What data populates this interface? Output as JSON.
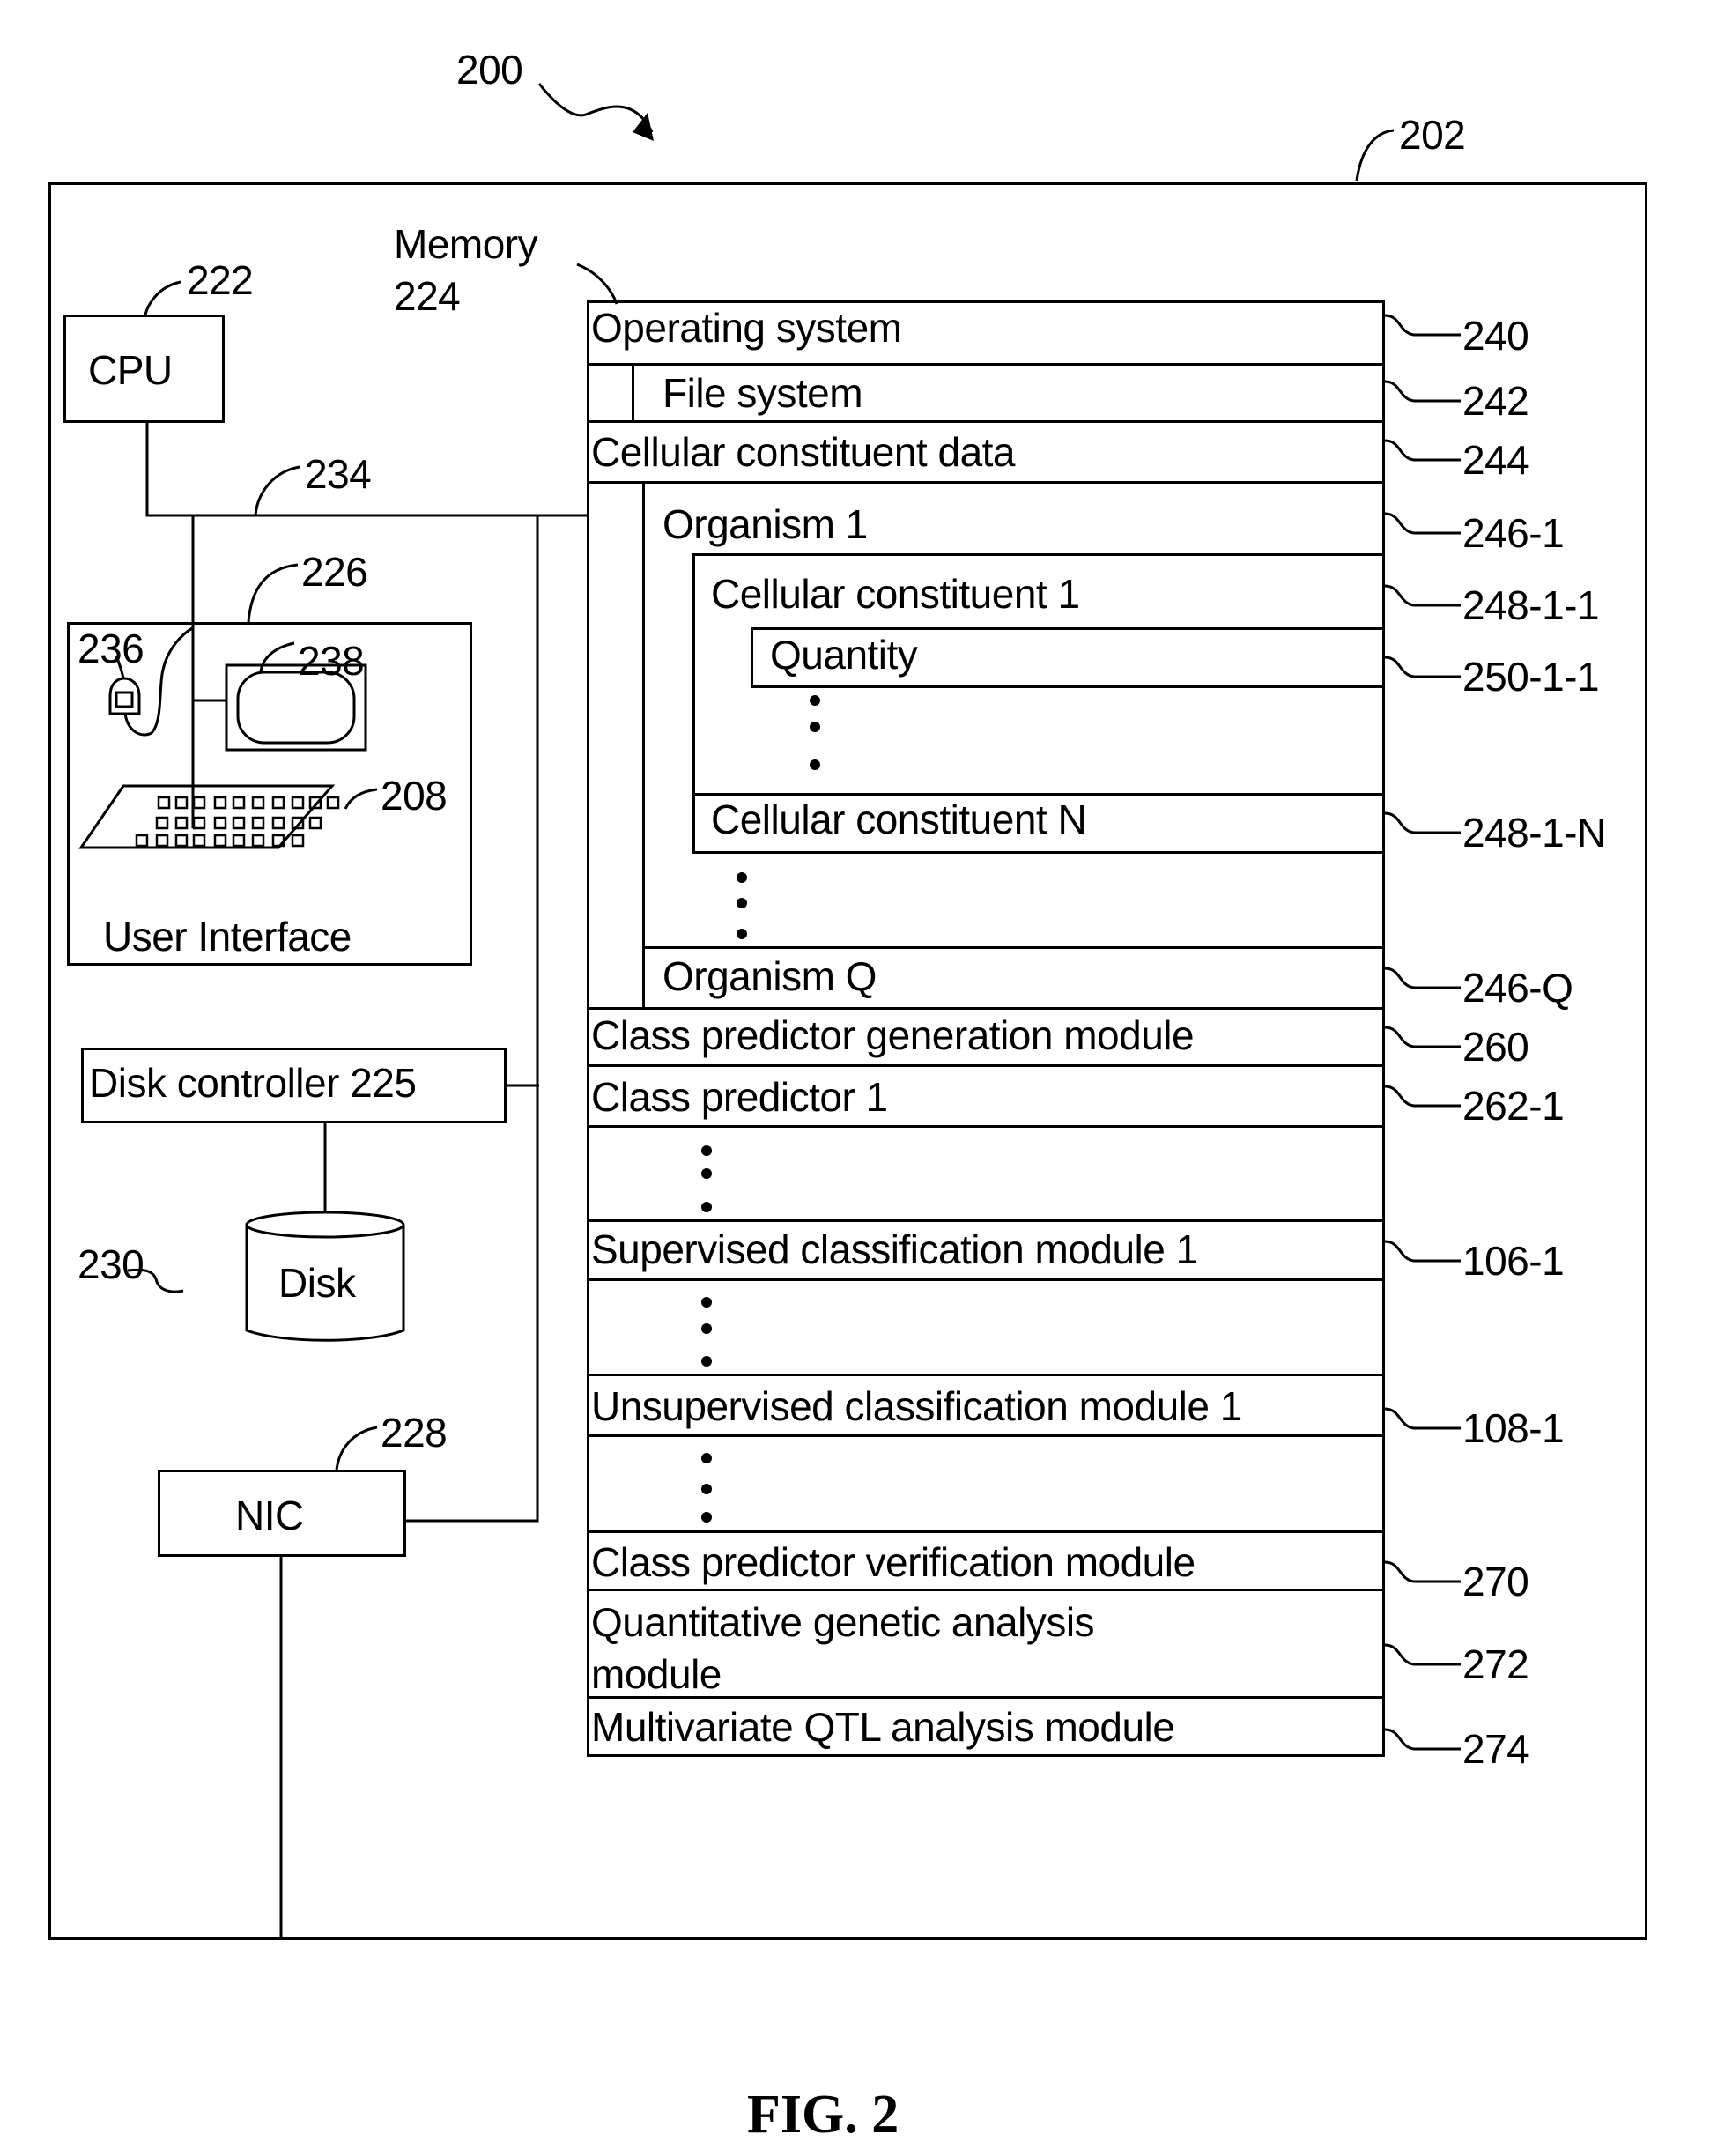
{
  "figure": {
    "caption": "FIG. 2",
    "system_ref": "200",
    "computer_ref": "202"
  },
  "components": {
    "cpu": {
      "label": "CPU",
      "ref": "222"
    },
    "memory": {
      "label": "Memory",
      "ref": "224"
    },
    "bus": {
      "ref": "234"
    },
    "user_interface": {
      "label": "User Interface",
      "ref": "226",
      "mouse_ref": "236",
      "display_ref": "238",
      "keyboard_ref": "208"
    },
    "disk_controller": {
      "label": "Disk controller 225"
    },
    "disk": {
      "label": "Disk",
      "ref": "230"
    },
    "nic": {
      "label": "NIC",
      "ref": "228"
    }
  },
  "memory_stack": [
    {
      "label": "Operating system",
      "ref": "240"
    },
    {
      "label": "File system",
      "ref": "242"
    },
    {
      "label": "Cellular constituent data",
      "ref": "244"
    },
    {
      "label": "Organism 1",
      "ref": "246-1"
    },
    {
      "label": "Cellular constituent 1",
      "ref": "248-1-1"
    },
    {
      "label": "Quantity",
      "ref": "250-1-1"
    },
    {
      "label": "Cellular constituent N",
      "ref": "248-1-N"
    },
    {
      "label": "Organism Q",
      "ref": "246-Q"
    },
    {
      "label": "Class predictor generation module",
      "ref": "260"
    },
    {
      "label": "Class predictor 1",
      "ref": "262-1"
    },
    {
      "label": "Supervised classification module 1",
      "ref": "106-1"
    },
    {
      "label": "Unsupervised classification module 1",
      "ref": "108-1"
    },
    {
      "label": "Class predictor verification module",
      "ref": "270"
    },
    {
      "label": "Quantitative genetic analysis module",
      "ref": "272",
      "line1": "Quantitative genetic analysis",
      "line2": "module"
    },
    {
      "label": "Multivariate QTL analysis module",
      "ref": "274"
    }
  ]
}
